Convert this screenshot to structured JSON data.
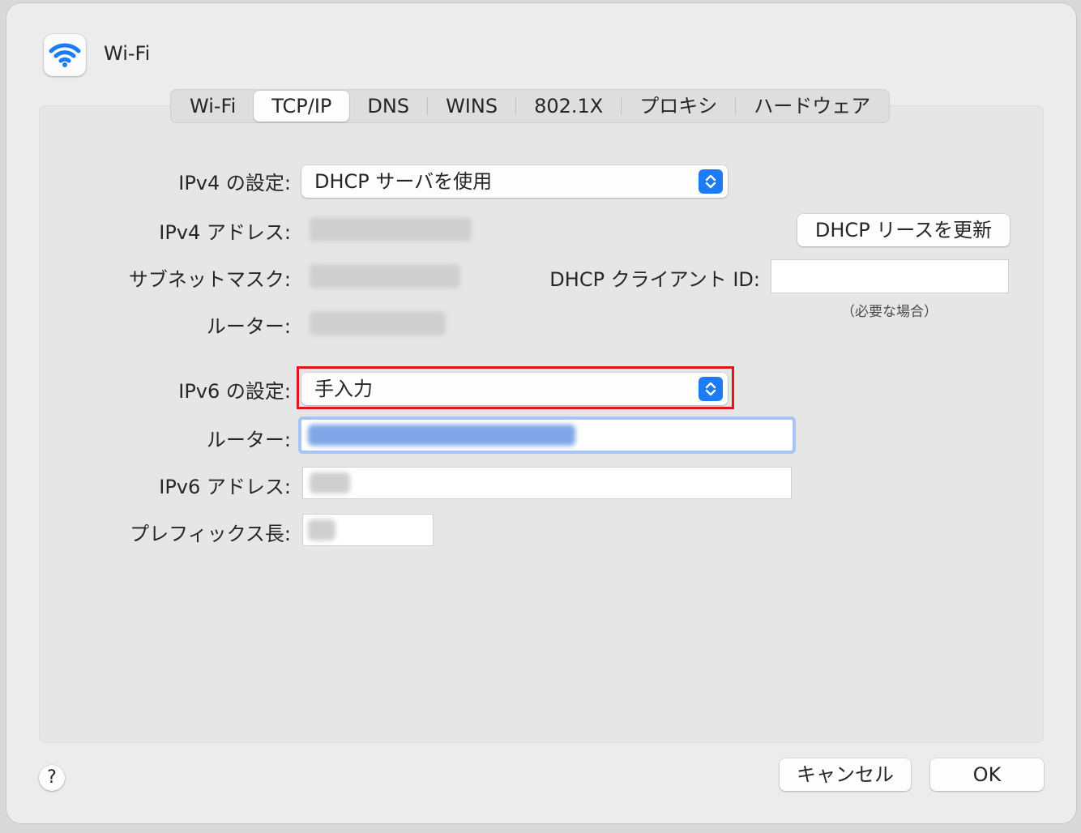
{
  "window": {
    "title": "Wi-Fi",
    "icon": "wifi-icon"
  },
  "tabs": [
    {
      "label": "Wi-Fi",
      "active": false
    },
    {
      "label": "TCP/IP",
      "active": true
    },
    {
      "label": "DNS",
      "active": false
    },
    {
      "label": "WINS",
      "active": false
    },
    {
      "label": "802.1X",
      "active": false
    },
    {
      "label": "プロキシ",
      "active": false
    },
    {
      "label": "ハードウェア",
      "active": false
    }
  ],
  "ipv4": {
    "config_label": "IPv4 の設定:",
    "config_value": "DHCP サーバを使用",
    "address_label": "IPv4 アドレス:",
    "subnet_label": "サブネットマスク:",
    "router_label": "ルーター:"
  },
  "dhcp": {
    "renew_button": "DHCP リースを更新",
    "client_id_label": "DHCP クライアント ID:",
    "client_id_value": "",
    "client_id_hint": "（必要な場合）"
  },
  "ipv6": {
    "config_label": "IPv6 の設定:",
    "config_value": "手入力",
    "router_label": "ルーター:",
    "address_label": "IPv6 アドレス:",
    "prefix_label": "プレフィックス長:"
  },
  "footer": {
    "help": "?",
    "cancel": "キャンセル",
    "ok": "OK"
  },
  "colors": {
    "accent": "#1b7cf5",
    "highlight": "#e0141c",
    "focus_ring": "#a6c5f5"
  }
}
